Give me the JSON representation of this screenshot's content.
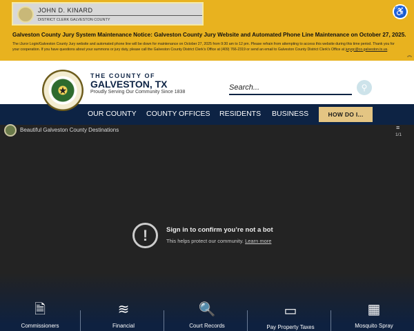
{
  "alert": {
    "clerk_name": "JOHN D. KINARD",
    "clerk_sub": "DISTRICT CLERK GALVESTON COUNTY",
    "title": "Galveston County Jury System Maintenance Notice:  Galveston County Jury Website and Automated Phone Line Maintenance on October 27, 2025.",
    "body": "The iJuror Login/Galveston County Jury website and automated phone line will be down for maintenance on October 27, 2025 from 9:30 am to 12 pm.  Please refrain from attempting to access this website during this time period. Thank you for your cooperation.  If you have questions about your summons or jury duty, please call the Galveston County District Clerk's Office at (409) 766-2319 or send an email to Galveston County District Clerk's Office at ",
    "email": "juryqc@co.galveston.tx.us"
  },
  "header": {
    "county_of": "THE COUNTY OF",
    "name": "GALVESTON, TX",
    "tagline": "Proudly Serving Our Community Since 1838",
    "search_placeholder": "Search..."
  },
  "nav": {
    "items": [
      "OUR COUNTY",
      "COUNTY OFFICES",
      "RESIDENTS",
      "BUSINESS"
    ],
    "how_do_i": "HOW DO I..."
  },
  "video": {
    "title": "Beautiful Galveston County Destinations",
    "count": "1/1",
    "bot_title": "Sign in to confirm you’re not a bot",
    "bot_sub": "This helps protect our community.",
    "learn_more": "Learn more"
  },
  "quick_links": [
    {
      "label": "Commissioners",
      "icon": "document-icon"
    },
    {
      "label": "Financial",
      "icon": "layers-icon"
    },
    {
      "label": "Court Records",
      "icon": "document-search-icon"
    },
    {
      "label": "Pay Property Taxes",
      "icon": "credit-card-icon"
    },
    {
      "label": "Mosquito Spray",
      "icon": "calendar-icon"
    }
  ],
  "colors": {
    "alert_bg": "#e8b21f",
    "navy": "#0d2344",
    "how_do_i": "#e4c583"
  }
}
